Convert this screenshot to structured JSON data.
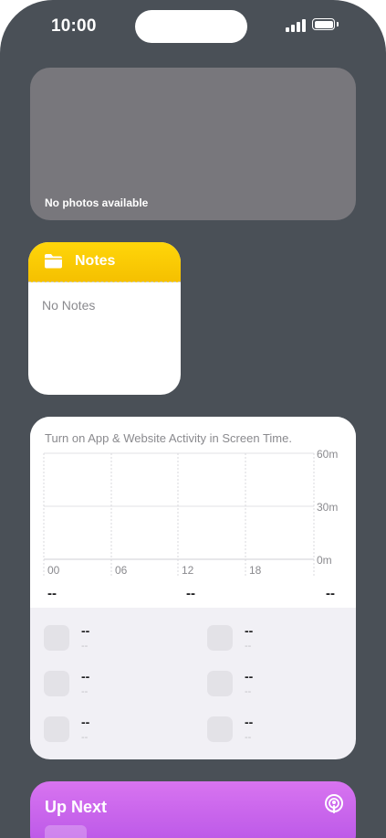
{
  "status_bar": {
    "time": "10:00"
  },
  "photos_widget": {
    "message": "No photos available"
  },
  "notes_widget": {
    "title": "Notes",
    "empty_message": "No Notes"
  },
  "screen_time_widget": {
    "message": "Turn on App & Website Activity in Screen Time.",
    "y_axis_labels": [
      "60m",
      "30m",
      "0m"
    ],
    "x_axis_labels": [
      "00",
      "06",
      "12",
      "18"
    ],
    "summary_values": [
      "--",
      "--",
      "--"
    ],
    "items": [
      {
        "value": "--",
        "sub": "--"
      },
      {
        "value": "--",
        "sub": "--"
      },
      {
        "value": "--",
        "sub": "--"
      },
      {
        "value": "--",
        "sub": "--"
      },
      {
        "value": "--",
        "sub": "--"
      },
      {
        "value": "--",
        "sub": "--"
      }
    ]
  },
  "up_next_widget": {
    "title": "Up Next"
  },
  "colors": {
    "background": "#4a5057",
    "notes_accent": "#ffd60a",
    "podcasts_accent": "#c964ec",
    "photos_placeholder": "#78777c"
  }
}
